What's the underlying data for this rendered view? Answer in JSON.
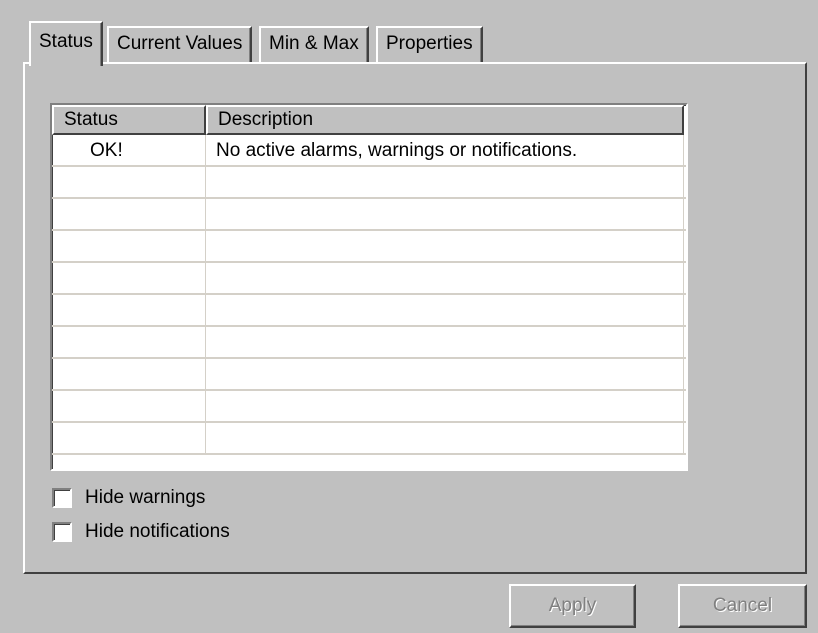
{
  "tabs": [
    {
      "label": "Status",
      "active": true
    },
    {
      "label": "Current Values",
      "active": false
    },
    {
      "label": "Min & Max",
      "active": false
    },
    {
      "label": "Properties",
      "active": false
    }
  ],
  "table": {
    "columns": [
      "Status",
      "Description"
    ],
    "rows": [
      {
        "status": "OK!",
        "description": "No active alarms, warnings or notifications."
      },
      {
        "status": "",
        "description": ""
      },
      {
        "status": "",
        "description": ""
      },
      {
        "status": "",
        "description": ""
      },
      {
        "status": "",
        "description": ""
      },
      {
        "status": "",
        "description": ""
      },
      {
        "status": "",
        "description": ""
      },
      {
        "status": "",
        "description": ""
      },
      {
        "status": "",
        "description": ""
      },
      {
        "status": "",
        "description": ""
      }
    ]
  },
  "options": {
    "hide_warnings": {
      "label": "Hide warnings",
      "checked": false
    },
    "hide_notifications": {
      "label": "Hide notifications",
      "checked": false
    }
  },
  "buttons": {
    "apply": {
      "label": "Apply",
      "enabled": false
    },
    "cancel": {
      "label": "Cancel",
      "enabled": false
    }
  }
}
